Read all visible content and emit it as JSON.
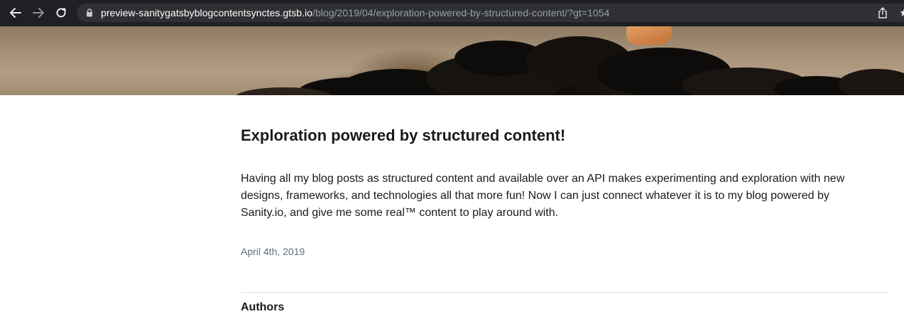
{
  "browser": {
    "url_host": "preview-sanitygatsbyblogcontentsynctes.gtsb.io",
    "url_path": "/blog/2019/04/exploration-powered-by-structured-content/?gt=1054",
    "icons": [
      "back-arrow-icon",
      "forward-arrow-icon",
      "reload-icon",
      "lock-icon",
      "share-icon",
      "star-icon"
    ]
  },
  "post": {
    "title": "Exploration powered by structured content!",
    "body": "Having all my blog posts as structured content and available over an API makes experimenting and exploration with new designs, frameworks, and technologies all that more fun! Now I can just connect whatever it is to my blog powered by Sanity.io, and give me some real™ content to play around with.",
    "date": "April 4th, 2019",
    "authors_heading": "Authors"
  },
  "colors": {
    "toolbar_bg": "#1f2023",
    "text": "#1a1a1a",
    "date": "#5f6e7d"
  }
}
